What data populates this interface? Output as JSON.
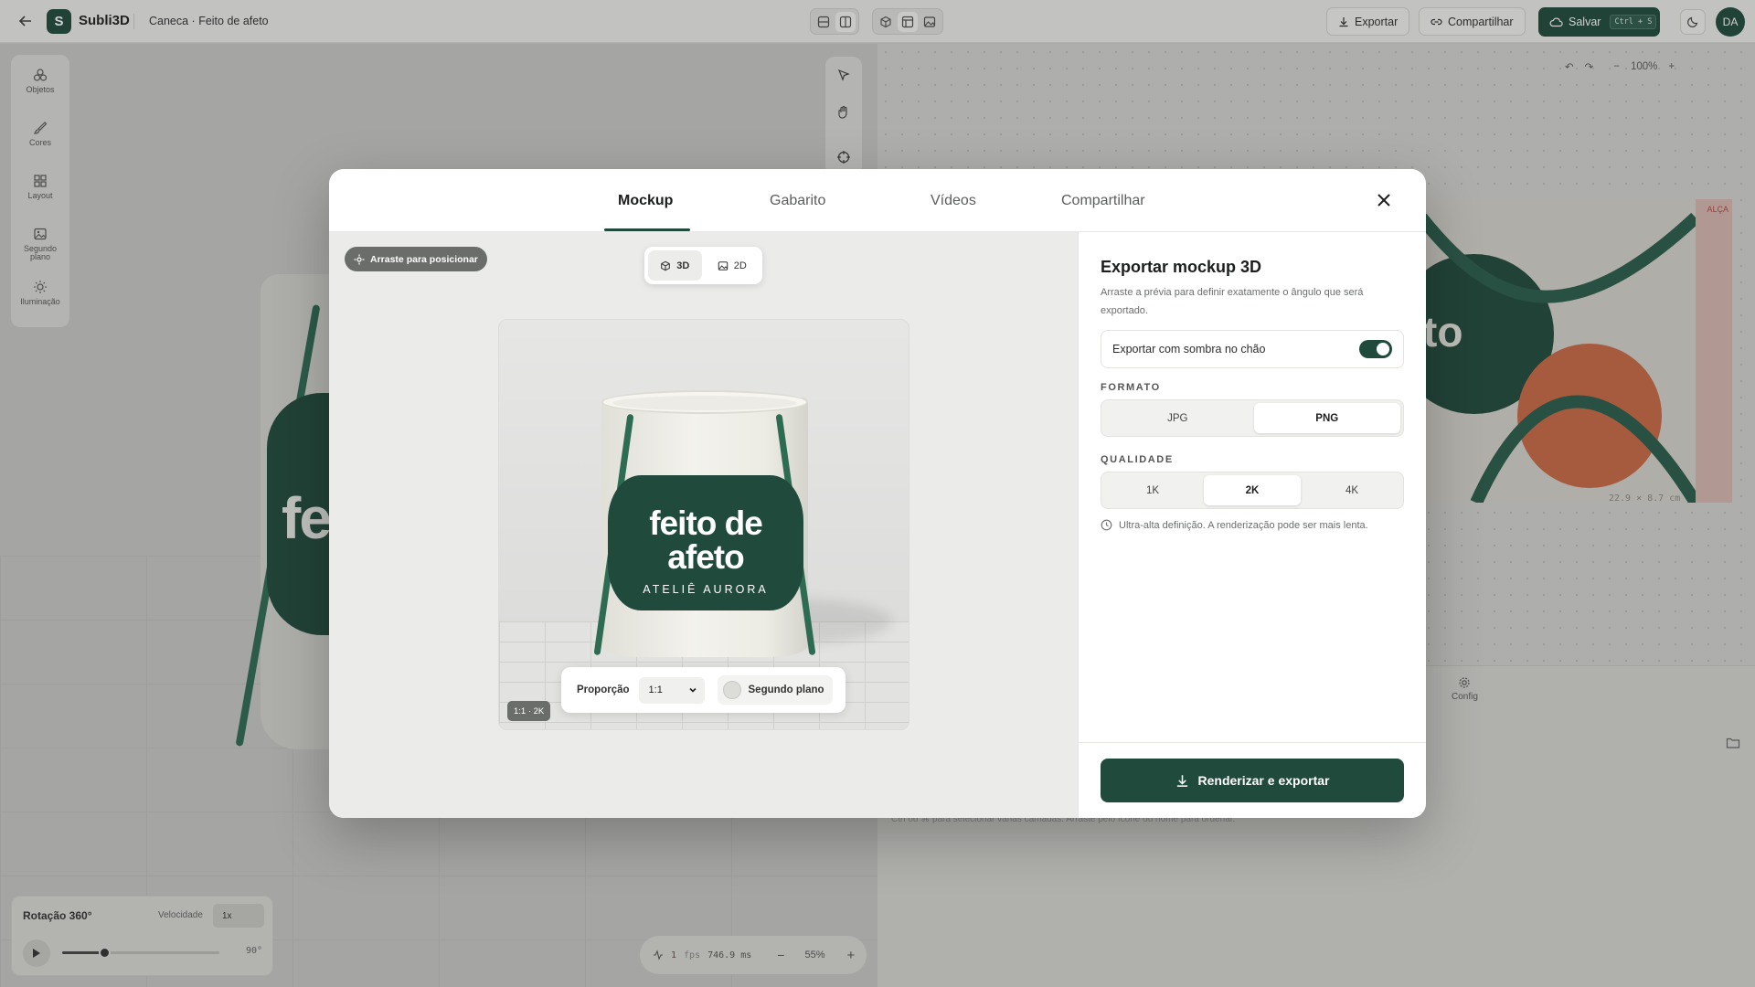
{
  "app": {
    "name": "Subli3D",
    "logo_letter": "S",
    "document_title": "Caneca · Feito de afeto"
  },
  "header": {
    "export_label": "Exportar",
    "share_label": "Compartilhar",
    "save_label": "Salvar",
    "save_shortcut": "Ctrl + S",
    "avatar_initials": "DA"
  },
  "left_tools": [
    {
      "label": "Objetos",
      "icon": "objects-icon"
    },
    {
      "label": "Cores",
      "icon": "brush-icon"
    },
    {
      "label": "Layout",
      "icon": "grid-icon"
    },
    {
      "label": "Segundo plano",
      "icon": "image-icon"
    },
    {
      "label": "Iluminação",
      "icon": "sun-icon"
    }
  ],
  "background": {
    "mug_text": "fei",
    "zoom_right": "100%",
    "zoom_left": "55%",
    "design_text": "to",
    "alca_label": "ALÇA",
    "dimensions": "22.9 × 8.7 cm",
    "config_label": "Config",
    "hint": "Ctrl ou ⌘ para selecionar várias camadas. Arraste pelo ícone ou nome para ordenar.",
    "fps_value": "1",
    "fps_label": "fps",
    "frame_ms": "746.9 ms",
    "rotation_title": "Rotação 360°",
    "speed_label": "Velocidade",
    "speed_value": "1x",
    "rotation_angle": "90°",
    "rotation_progress": 0.27
  },
  "modal": {
    "tabs": [
      "Mockup",
      "Gabarito",
      "Vídeos",
      "Compartilhar"
    ],
    "active_tab": "Mockup",
    "drag_hint": "Arraste para posicionar",
    "view_3d": "3D",
    "view_2d": "2D",
    "mug_line1": "feito de afeto",
    "mug_line2": "ATELIÊ AURORA",
    "ratio_badge": "1:1 · 2K",
    "proportion_label": "Proporção",
    "proportion_value": "1:1",
    "background_toggle": "Segundo plano",
    "export": {
      "title": "Exportar mockup 3D",
      "description": "Arraste a prévia para definir exatamente o ângulo que será exportado.",
      "shadow_label": "Exportar com sombra no chão",
      "shadow_on": true,
      "format_label": "FORMATO",
      "formats": [
        "JPG",
        "PNG"
      ],
      "format_selected": "PNG",
      "quality_label": "QUALIDADE",
      "qualities": [
        "1K",
        "2K",
        "4K"
      ],
      "quality_selected": "2K",
      "quality_note": "Ultra-alta definição. A renderização pode ser mais lenta.",
      "render_label": "Renderizar e exportar"
    }
  },
  "colors": {
    "brand": "#1f4a3c",
    "accent_orange": "#c96a45"
  }
}
